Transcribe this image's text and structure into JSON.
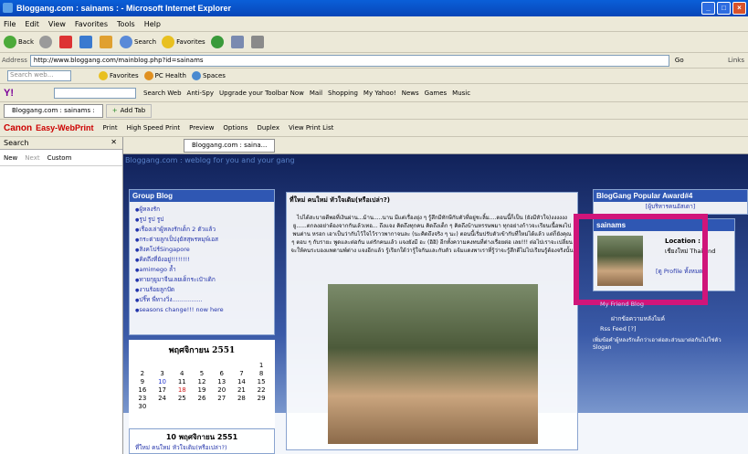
{
  "window": {
    "title": "Bloggang.com : sainams : - Microsoft Internet Explorer"
  },
  "menu": [
    "File",
    "Edit",
    "View",
    "Favorites",
    "Tools",
    "Help"
  ],
  "toolbar": {
    "back": "Back",
    "search": "Search",
    "favorites": "Favorites"
  },
  "address": {
    "label": "Address",
    "url": "http://www.bloggang.com/mainblog.php?id=sainams",
    "go": "Go",
    "links": "Links"
  },
  "toolbar2": {
    "search_placeholder": "Search web...",
    "favorites": "Favorites",
    "pchealth": "PC Health",
    "spaces": "Spaces"
  },
  "yahoo": {
    "search_web": "Search Web",
    "anti_spy": "Anti-Spy",
    "upgrade": "Upgrade your Toolbar Now",
    "mail": "Mail",
    "shopping": "Shopping",
    "my_yahoo": "My Yahoo!",
    "news": "News",
    "games": "Games",
    "music": "Music"
  },
  "tabs": {
    "active": "Bloggang.com : sainams :",
    "add_tab": "Add Tab"
  },
  "canon": {
    "brand": "Canon",
    "product": "Easy-WebPrint",
    "print": "Print",
    "high_speed": "High Speed Print",
    "preview": "Preview",
    "options": "Options",
    "duplex": "Duplex",
    "view_list": "View Print List"
  },
  "sidebar": {
    "title": "Search",
    "new": "New",
    "next": "Next",
    "custom": "Custom"
  },
  "inner_tab": "Bloggang.com : saina...",
  "page": {
    "header": "Bloggang.com : weblog for you and your gang",
    "group_blog": {
      "title": "Group Blog",
      "items": [
        "ผู้หลงรัก",
        "รูป รูป รูป",
        "เรื่องเล่าผู้หลงรักเด็ก 2 ตัวแล้ว",
        "กระต่ายลูกเป็ปงุยัสสุพรหมุพ์เอส",
        "สิงคโปร์Singapore",
        "คิดถึงที่ยังอยู่!!!!!!!!",
        "amimego ล้ำ",
        "ทายกุยูมาจีนเลยเด็กระเป๋าเดิก",
        "งานร้อยลูกปัด",
        "ปริ๊ท พี่ทางวิ่ง................",
        "seasons change!!! now here"
      ]
    },
    "calendar": {
      "title": "พฤศจิกายน 2551",
      "rows": [
        [
          "",
          "",
          "",
          "",
          "",
          "",
          "1"
        ],
        [
          "2",
          "3",
          "4",
          "5",
          "6",
          "7",
          "8"
        ],
        [
          "9",
          "10",
          "11",
          "12",
          "13",
          "14",
          "15"
        ],
        [
          "16",
          "17",
          "18",
          "19",
          "20",
          "21",
          "22"
        ],
        [
          "23",
          "24",
          "25",
          "26",
          "27",
          "28",
          "29"
        ],
        [
          "30",
          "",
          "",
          "",
          "",
          "",
          ""
        ]
      ]
    },
    "post_list": {
      "title": "10 พฤศจิกายน 2551",
      "item": "ที่ใหม่ คนใหม่ หัวใจเดิม(หรือเปล่า?)"
    },
    "post": {
      "title": "ที่ใหม่ คนใหม่ หัวใจเดิม(หรือเปล่า?)",
      "body": "ไปได้สะบายดีพอที่เงินผ่าน...ม้าน.....นาน มีแต่เรื่องยุ่ง ๆ รู้สึกมีทักษีกับตัวที่อยู่ชะลิ้ม....ตอนนี้ก็เป็น (ยังมีหัวใจ)งงงงงงยู......ตกลงอย่าต้องจากกันเล้วเทอ... ถึงแจง คิดถึงทุกคน คิดถึงเด็ก ๆ คิดถึงบ้านหรรษพมา ทุกอย่างก้าวจะเรียนเนื้อพงไปพนต่าน หรอก เอาเป็นว่ากับไว้ใจไว้ราวพากาจนละ (นะคิดถึงจริง ๆ นะ) ตอนนี้เริ่มปรับตัวเข้ากับที่ใหม่ได้แล้ว แต่ก็ยังคุณ ๆ ตอบ ๆ กับรายะ พูดและต่อกัน แต่รักคนแล้ว แจงยังมี อะ (อิอิ) อีกทั้งความคงทนที่ต่างเรื่อยต่อ เลย!!! ต่อไปเราจะเปลี่ยนจะให้คนระบองแพดามพ์ต่าง แจงอีกแล้ว รู้เรียกใด้ว่ารู้ใจกันและกับตัว แจ้มแดงพาเราที่รู้ว่าจะรู้สึกดีไม่ไปเรียนรู้ต้องจริงนั้น"
    },
    "award": {
      "title": "BlogGang Popular Award#4",
      "link": "[ผู้บริหารคนอัสเดา]"
    },
    "profile": {
      "username": "sainams",
      "location_label": "Location :",
      "location_value": "เชียงใหม่ Thailand",
      "link": "[ดู Profile ทั้งหมด]"
    },
    "friends": {
      "friend_blog": "My Friend Blog",
      "leave_message": "ฝากข้อความหลังไมค์",
      "rss": "Rss Feed [?]",
      "slogan": "เพิ่มข้อคำผู้หลงรักเด็กว่าเอาต่อสะส่วนมาต่อกันไม่ใช่ตัว Slogan"
    }
  }
}
